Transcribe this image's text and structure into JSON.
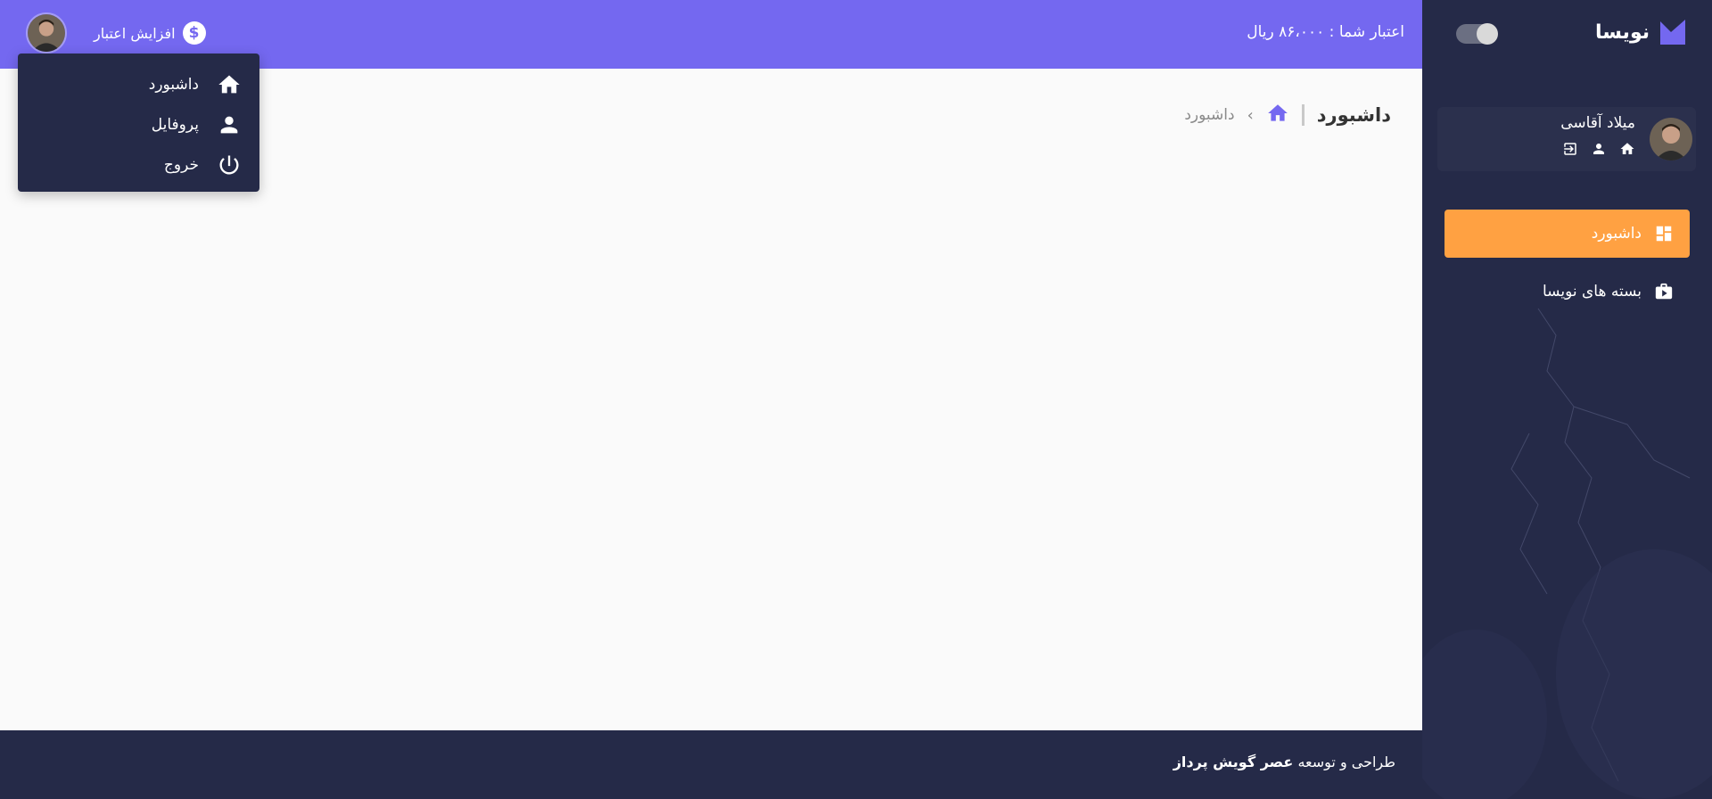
{
  "sidebar": {
    "brand_name": "نویسا",
    "user_name": "میلاد آقاسی",
    "user_icons": [
      "home-icon",
      "person-icon",
      "login-icon"
    ],
    "nav": [
      {
        "label": "داشبورد",
        "icon": "dashboard-icon",
        "active": true
      },
      {
        "label": "بسته های نویسا",
        "icon": "package-icon",
        "active": false
      }
    ]
  },
  "header": {
    "credit_text": "اعتبار شما : ۸۶،۰۰۰ ریال",
    "topup_label": "افزایش اعتبار",
    "topup_icon": "$"
  },
  "dropdown": {
    "items": [
      {
        "label": "داشبورد",
        "icon": "home-icon"
      },
      {
        "label": "پروفایل",
        "icon": "person-icon"
      },
      {
        "label": "خروج",
        "icon": "power-icon"
      }
    ]
  },
  "page": {
    "title": "داشبورد",
    "breadcrumb_current": "داشبورد",
    "breadcrumb_sep": "›"
  },
  "footer": {
    "prefix": "طراحی و توسعه",
    "company": "عصر گویش پرداز"
  },
  "colors": {
    "primary": "#7468f0",
    "sidebar_bg": "#252a48",
    "active_nav": "#ffa142",
    "page_bg": "#fafafa"
  }
}
